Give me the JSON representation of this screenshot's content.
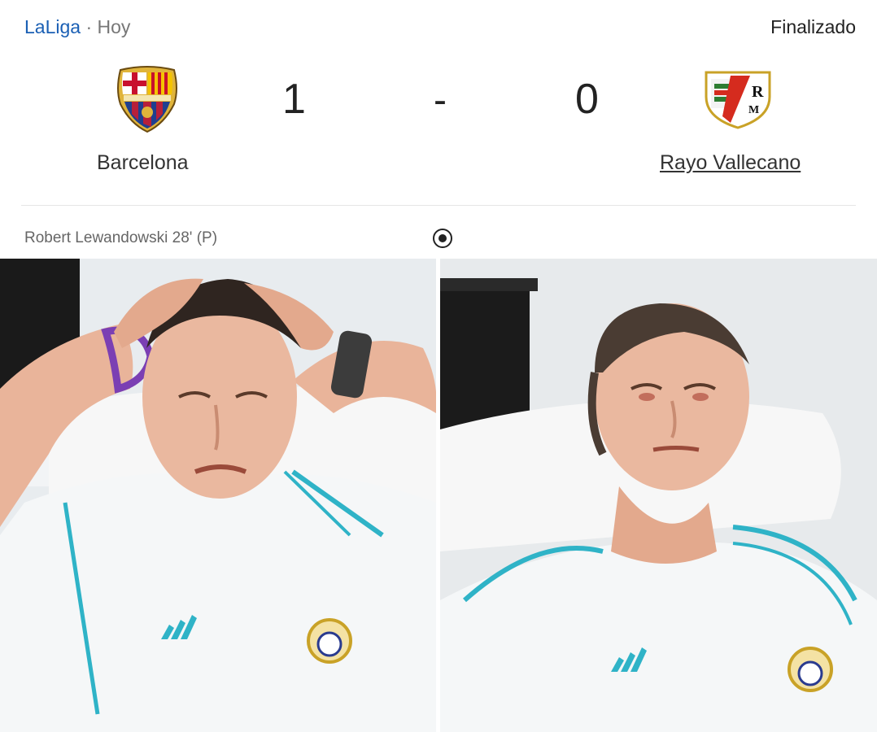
{
  "header": {
    "league": "LaLiga",
    "separator": "·",
    "day": "Hoy",
    "status": "Finalizado"
  },
  "match": {
    "home": {
      "name": "Barcelona",
      "score": "1",
      "crest": "barcelona-crest"
    },
    "score_separator": "-",
    "away": {
      "name": "Rayo Vallecano",
      "score": "0",
      "crest": "rayo-vallecano-crest"
    }
  },
  "events": [
    {
      "text": "Robert Lewandowski 28' (P)",
      "icon": "soccer-ball-icon"
    }
  ],
  "photos": [
    {
      "name": "man-hands-on-head",
      "shirt_brand": "adidas"
    },
    {
      "name": "man-teary-eyes",
      "shirt_brand": "adidas"
    }
  ],
  "colors": {
    "league_link": "#1a5fb4",
    "barca_blue": "#1f3f8f",
    "barca_red": "#b71f3a",
    "rayo_red": "#d52b1e",
    "jersey_teal": "#2fb3c7"
  }
}
